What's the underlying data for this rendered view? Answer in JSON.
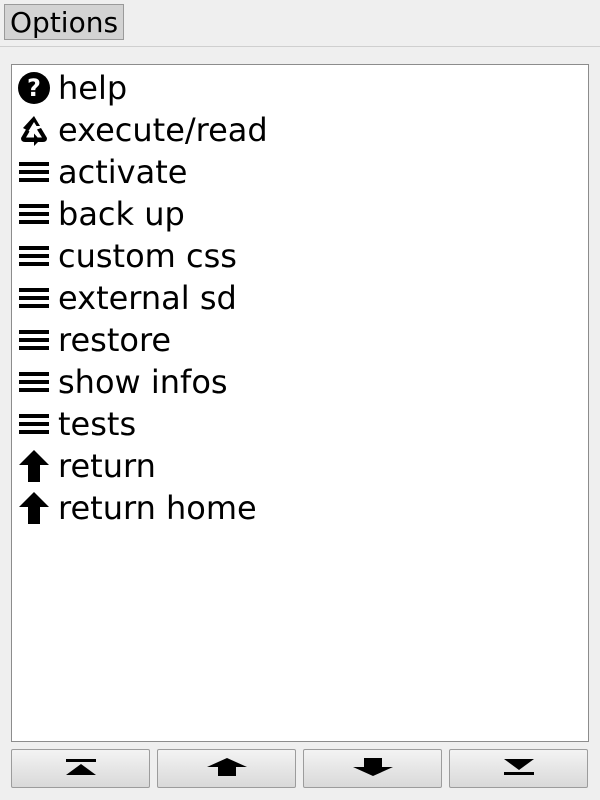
{
  "header": {
    "options_label": "Options"
  },
  "menu": {
    "items": [
      {
        "label": "help",
        "icon": "question-circle-icon"
      },
      {
        "label": "execute/read",
        "icon": "recycle-icon"
      },
      {
        "label": "activate",
        "icon": "hamburger-menu-icon"
      },
      {
        "label": "back up",
        "icon": "hamburger-menu-icon"
      },
      {
        "label": "custom css",
        "icon": "hamburger-menu-icon"
      },
      {
        "label": "external sd",
        "icon": "hamburger-menu-icon"
      },
      {
        "label": "restore",
        "icon": "hamburger-menu-icon"
      },
      {
        "label": "show infos",
        "icon": "hamburger-menu-icon"
      },
      {
        "label": "tests",
        "icon": "hamburger-menu-icon"
      },
      {
        "label": "return",
        "icon": "arrow-up-icon"
      },
      {
        "label": "return home",
        "icon": "arrow-up-icon"
      }
    ]
  },
  "footer": {
    "buttons": [
      {
        "icon": "scroll-to-top-icon"
      },
      {
        "icon": "page-up-icon"
      },
      {
        "icon": "page-down-icon"
      },
      {
        "icon": "scroll-to-bottom-icon"
      }
    ]
  }
}
